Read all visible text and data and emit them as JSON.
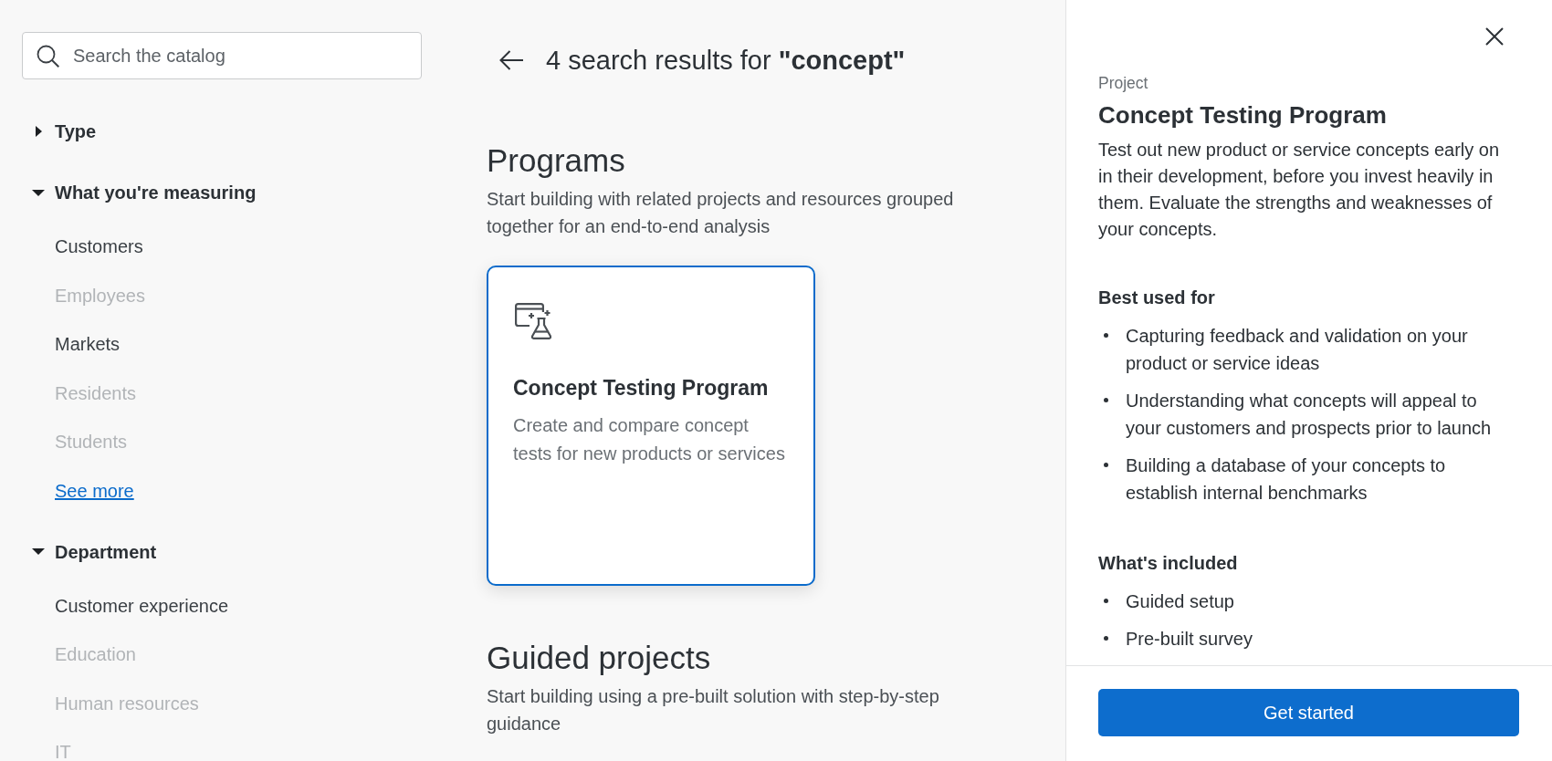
{
  "sidebar": {
    "search": {
      "placeholder": "Search the catalog"
    },
    "filters": [
      {
        "label": "Type",
        "expanded": false
      },
      {
        "label": "What you're measuring",
        "expanded": true,
        "options": [
          {
            "label": "Customers",
            "disabled": false
          },
          {
            "label": "Employees",
            "disabled": true
          },
          {
            "label": "Markets",
            "disabled": false
          },
          {
            "label": "Residents",
            "disabled": true
          },
          {
            "label": "Students",
            "disabled": true
          }
        ],
        "see_more": "See more"
      },
      {
        "label": "Department",
        "expanded": true,
        "options": [
          {
            "label": "Customer experience",
            "disabled": false
          },
          {
            "label": "Education",
            "disabled": true
          },
          {
            "label": "Human resources",
            "disabled": true
          },
          {
            "label": "IT",
            "disabled": true
          }
        ]
      }
    ]
  },
  "results": {
    "title": "4 search results for **\"concept\"**",
    "sections": [
      {
        "heading": "Programs",
        "description": "Start building with related projects and resources grouped together for an end-to-end analysis",
        "cards": [
          {
            "title": "Concept Testing Program",
            "description": "Create and compare concept tests for new products or services",
            "selected": true
          }
        ]
      },
      {
        "heading": "Guided projects",
        "description": "Start building using a pre-built solution with step-by-step guidance"
      }
    ]
  },
  "detail_panel": {
    "type_label": "Project",
    "title": "Concept Testing Program",
    "description": "Test out new product or service concepts early on in their development, before you invest heavily in them. Evaluate the strengths and weaknesses of your concepts.",
    "sections": [
      {
        "heading": "Best used for",
        "items": [
          "Capturing feedback and validation on your product or service ideas",
          "Understanding what concepts will appeal to your customers and prospects prior to launch",
          "Building a database of your concepts to establish internal benchmarks"
        ]
      },
      {
        "heading": "What's included",
        "items": [
          "Guided setup",
          "Pre-built survey"
        ]
      }
    ],
    "primary_button": "Get started"
  }
}
